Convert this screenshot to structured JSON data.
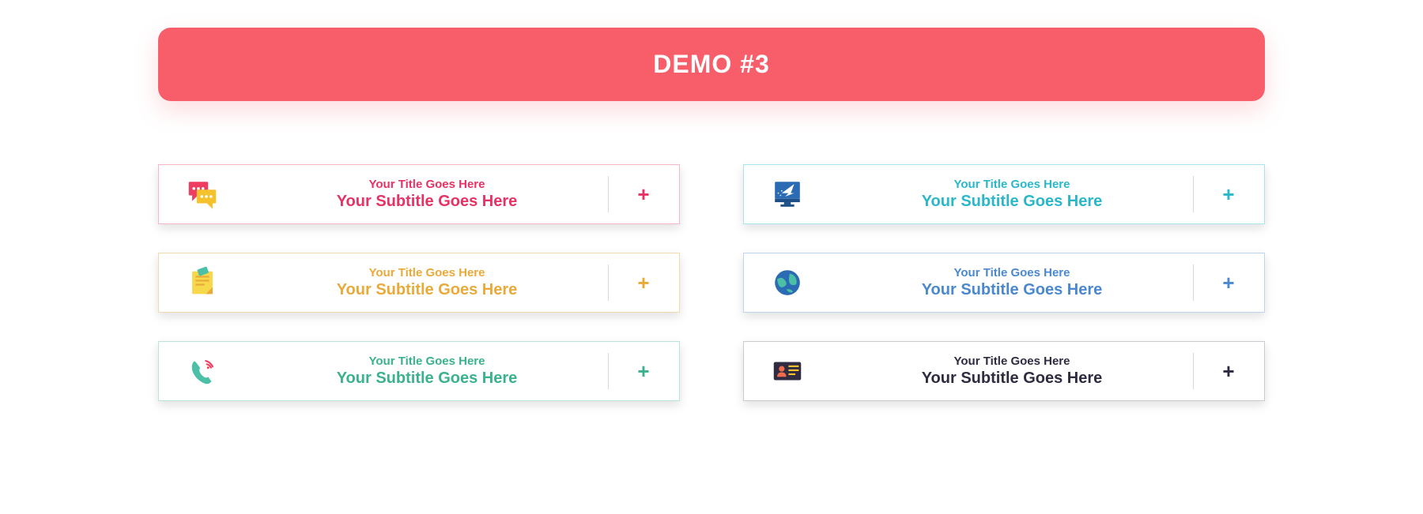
{
  "header": {
    "title": "DEMO #3"
  },
  "cards": [
    {
      "icon": "chat-bubbles-icon",
      "title": "Your Title Goes Here",
      "subtitle": "Your Subtitle Goes Here",
      "color_class": "c-pink",
      "accent": "#e73265"
    },
    {
      "icon": "computer-send-icon",
      "title": "Your Title Goes Here",
      "subtitle": "Your Subtitle Goes Here",
      "color_class": "c-cyan",
      "accent": "#2ab7ca"
    },
    {
      "icon": "sticky-note-icon",
      "title": "Your Title Goes Here",
      "subtitle": "Your Subtitle Goes Here",
      "color_class": "c-orange",
      "accent": "#e9aa3a"
    },
    {
      "icon": "globe-icon",
      "title": "Your Title Goes Here",
      "subtitle": "Your Subtitle Goes Here",
      "color_class": "c-blue",
      "accent": "#4a88cf"
    },
    {
      "icon": "phone-ringing-icon",
      "title": "Your Title Goes Here",
      "subtitle": "Your Subtitle Goes Here",
      "color_class": "c-green",
      "accent": "#3bb28f"
    },
    {
      "icon": "id-card-icon",
      "title": "Your Title Goes Here",
      "subtitle": "Your Subtitle Goes Here",
      "color_class": "c-dark",
      "accent": "#2f2b41"
    }
  ],
  "plus_label": "+"
}
